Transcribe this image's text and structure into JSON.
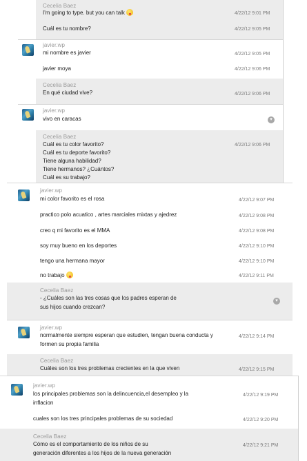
{
  "conversation": [
    {
      "sender": "Cecelia Baez",
      "lines": [
        {
          "text": "I'm going to type. but you can talk",
          "emoji": true,
          "time": "4/22/12 9:01 PM"
        },
        {
          "text": "Cuál es tu nombre?",
          "time": "4/22/12 9:05 PM"
        }
      ]
    },
    {
      "sender": "javier.wp",
      "lines": [
        {
          "text": "mi nombre es javier",
          "time": "4/22/12 9:05 PM"
        },
        {
          "text": "javier moya",
          "time": "4/22/12 9:06 PM"
        }
      ]
    },
    {
      "sender": "Cecelia Baez",
      "lines": [
        {
          "text": "En qué ciudad vive?",
          "time": "4/22/12 9:06 PM"
        }
      ]
    },
    {
      "sender": "javier.wp",
      "lines": [
        {
          "text": "vivo en caracas",
          "time": ""
        }
      ]
    },
    {
      "sender": "Cecelia Baez",
      "lines": [
        {
          "text": "Cuál es tu color favorito?",
          "time": "4/22/12 9:06 PM"
        },
        {
          "text": "Cuál es tu deporte favorito?"
        },
        {
          "text": "Tiene alguna habilidad?"
        },
        {
          "text": "Tiene hermanos? ¿Cuántos?"
        },
        {
          "text": "Cuál es su trabajo?"
        }
      ]
    },
    {
      "sender": "javier.wp",
      "lines": [
        {
          "text": "mi color favorito es el rosa",
          "time": "4/22/12 9:07 PM"
        },
        {
          "text": "practico polo acuatico , artes marciales mixtas y ajedrez",
          "time": "4/22/12 9:08 PM"
        },
        {
          "text": "creo q mi favorito es el MMA",
          "time": "4/22/12 9:08 PM"
        },
        {
          "text": "soy muy bueno en los deportes",
          "time": "4/22/12 9:10 PM"
        },
        {
          "text": "tengo una hermana mayor",
          "time": "4/22/12 9:10 PM"
        },
        {
          "text": "no trabajo",
          "emoji": true,
          "time": "4/22/12 9:11 PM"
        }
      ]
    },
    {
      "sender": "Cecelia Baez",
      "lines": [
        {
          "text": "- ¿Cuáles son las tres cosas que los padres esperan de"
        },
        {
          "text": "sus hijos cuando crezcan?"
        }
      ]
    },
    {
      "sender": "javier.wp",
      "lines": [
        {
          "text": "normalmente siempre esperan que estudien, tengan buena conducta y",
          "time": "4/22/12 9:14 PM"
        },
        {
          "text": "formen su propia familia"
        }
      ]
    },
    {
      "sender": "Cecelia Baez",
      "lines": [
        {
          "text": "Cuáles son los tres problemas crecientes en la que viven",
          "time": "4/22/12 9:15 PM"
        }
      ]
    },
    {
      "sender": "javier.wp",
      "lines": [
        {
          "text": "los principales problemas son la delincuencia,el desempleo y la",
          "time": "4/22/12 9:19 PM"
        },
        {
          "text": "inflacion"
        },
        {
          "text": "cuales son  los tres principales problemas de su sociedad",
          "time": "4/22/12 9:20 PM"
        }
      ]
    },
    {
      "sender": "Cecelia Baez",
      "lines": [
        {
          "text": "Cómo es el comportamiento de los niños de su",
          "time": "4/22/12 9:21 PM"
        },
        {
          "text": "generación diferentes a los hijos de la nueva generación"
        }
      ]
    }
  ]
}
